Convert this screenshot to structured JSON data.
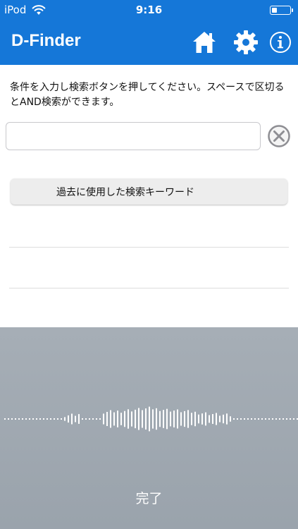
{
  "status_bar": {
    "carrier": "iPod",
    "time": "9:16",
    "battery_level": 0.3
  },
  "nav_bar": {
    "title": "D-Finder",
    "icons": [
      "home-icon",
      "gear-icon",
      "info-icon"
    ],
    "background": "#1577d8"
  },
  "search": {
    "instruction": "条件を入力し検索ボタンを押してください。スペースで区切るとAND検索ができます。",
    "value": "",
    "placeholder": ""
  },
  "history": {
    "button_label": "過去に使用した検索キーワード",
    "items": [
      "",
      ""
    ]
  },
  "dictation": {
    "done_label": "完了"
  }
}
